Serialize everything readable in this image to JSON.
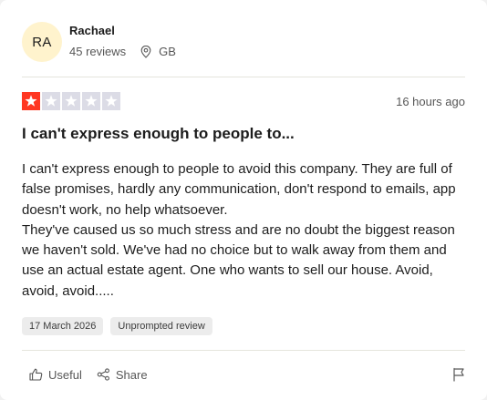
{
  "reviewer": {
    "initials": "RA",
    "name": "Rachael",
    "reviews_count": "45 reviews",
    "country": "GB"
  },
  "review": {
    "rating": 1,
    "max_rating": 5,
    "posted_ago": "16 hours ago",
    "title": "I can't express enough to people to...",
    "body_paragraph_1": "I can't express enough to people to avoid this company. They are full of false promises, hardly any communication, don't respond to emails, app doesn't work, no help whatsoever.",
    "body_paragraph_2": "They've caused us so much stress and are no doubt the biggest reason we haven't sold. We've had no choice but to walk away from them and use an actual estate agent. One who wants to sell our house. Avoid, avoid, avoid.....",
    "experience_date": "17 March 2026",
    "review_type": "Unprompted review"
  },
  "actions": {
    "useful_label": "Useful",
    "share_label": "Share"
  },
  "icons": {
    "location": "location-pin-icon",
    "useful": "thumbs-up-icon",
    "share": "share-icon",
    "report": "flag-icon",
    "star": "star-icon"
  },
  "colors": {
    "star_filled": "#ff3722",
    "star_empty": "#dcdce6",
    "avatar_bg": "#fff3cd"
  }
}
